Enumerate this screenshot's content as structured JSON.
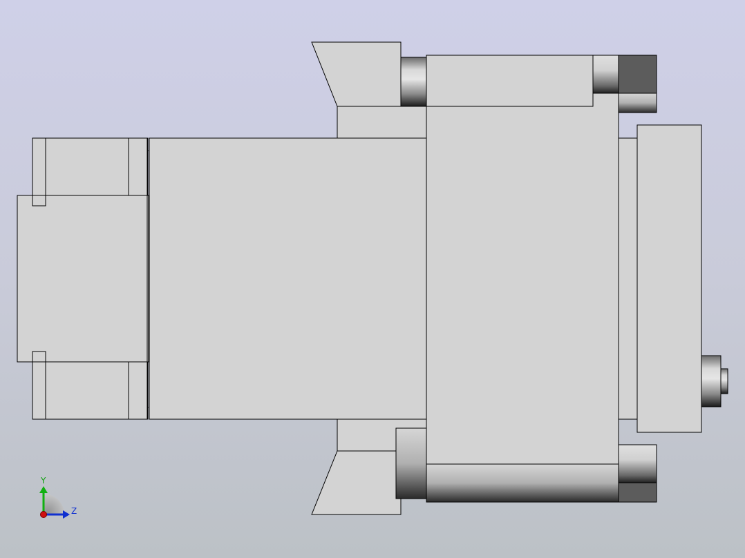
{
  "colors": {
    "background_top": "#cfd0e8",
    "background_bottom": "#bcc1c6",
    "part_face": "#d3d3d3",
    "part_edge": "#000000",
    "dark_face": "#5c5c5c",
    "axis_x": "#d01010",
    "axis_y": "#10b010",
    "axis_z": "#1030d0"
  },
  "triad": {
    "y_label": "Y",
    "z_label": "Z"
  }
}
